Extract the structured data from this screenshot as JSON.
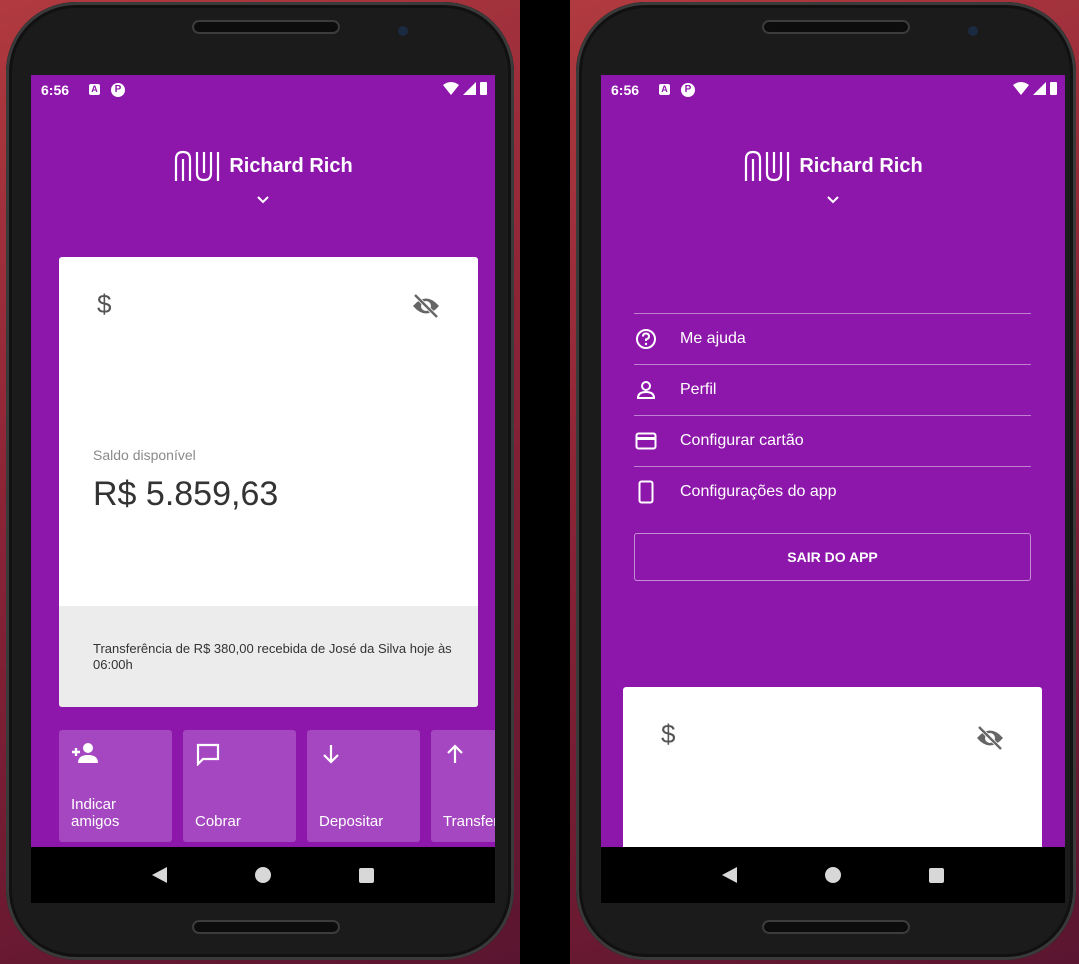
{
  "status": {
    "time": "6:56",
    "badge_a": "A",
    "badge_p": "P"
  },
  "header": {
    "user_name": "Richard Rich"
  },
  "account": {
    "currency_icon": "$",
    "balance_label": "Saldo disponível",
    "balance_value": "R$ 5.859,63",
    "notification": "Transferência de R$ 380,00 recebida de José da Silva hoje às 06:00h"
  },
  "shortcuts": [
    {
      "label": "Indicar amigos",
      "icon": "person-add-icon"
    },
    {
      "label": "Cobrar",
      "icon": "chat-icon"
    },
    {
      "label": "Depositar",
      "icon": "arrow-down-icon"
    },
    {
      "label": "Transferir",
      "icon": "arrow-up-icon"
    }
  ],
  "menu": {
    "items": [
      {
        "label": "Me ajuda",
        "icon": "help-icon"
      },
      {
        "label": "Perfil",
        "icon": "person-icon"
      },
      {
        "label": "Configurar cartão",
        "icon": "credit-card-icon"
      },
      {
        "label": "Configurações do app",
        "icon": "smartphone-icon"
      }
    ],
    "logout_label": "SAIR DO APP"
  },
  "colors": {
    "primary": "#8e17ab",
    "shortcut_bg": "#a547c0",
    "card_footer": "#ececec"
  }
}
